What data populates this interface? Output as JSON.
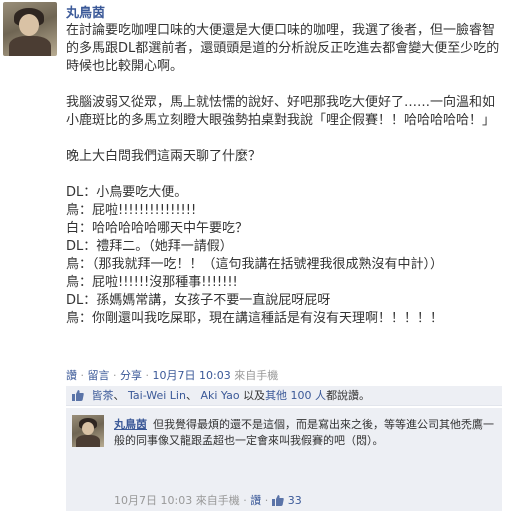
{
  "post": {
    "author": "丸鳥茵",
    "paragraphs": [
      "在討論要吃咖哩口味的大便還是大便口味的咖哩，我選了後者，但一臉睿智的多馬跟DL都選前者，還頭頭是道的分析說反正吃進去都會變大便至少吃的時候也比較開心啊。",
      "我腦波弱又從眾，馬上就怯懦的說好、好吧那我吃大便好了……一向溫和如小鹿斑比的多馬立刻瞪大眼強勢拍桌對我說「哩企假賽！！哈哈哈哈哈！」",
      "晚上大白問我們這兩天聊了什麼？",
      "DL：小鳥要吃大便。\n鳥：屁啦!!!!!!!!!!!!!!!\n白：哈哈哈哈哈哪天中午要吃？\nDL：禮拜二。（她拜一請假）\n鳥：（那我就拜一吃！！（這句我講在括號裡我很成熟沒有中計））\n鳥：屁啦!!!!!!沒那種事!!!!!!!\nDL：孫媽媽常講，女孩子不要一直說屁呀屁呀\n鳥：你剛還叫我吃屎耶，現在講這種話是有沒有天理啊！！！！！"
    ]
  },
  "actions": {
    "like": "讚",
    "comment": "留言",
    "share": "分享",
    "time": "10月7日 10:03",
    "via": "來自手機",
    "sep": " · "
  },
  "likes": {
    "names": [
      "皆茶",
      "Tai-Wei Lin",
      "Aki Yao"
    ],
    "text_and": "以及",
    "text_others": "其他 100 人",
    "text_suffix": "都說讚。"
  },
  "comment": {
    "author": "丸鳥茵",
    "text": "但我覺得最煩的還不是這個，而是寫出來之後，等等進公司其他禿鷹一般的同事像又龍跟孟超也一定會來叫我假賽的吧（悶）。",
    "time": "10月7日 10:03",
    "via": "來自手機",
    "like": "讚",
    "like_count": "33"
  },
  "colors": {
    "link": "#3b5998",
    "meta": "#999999",
    "panel": "#edeff4"
  }
}
